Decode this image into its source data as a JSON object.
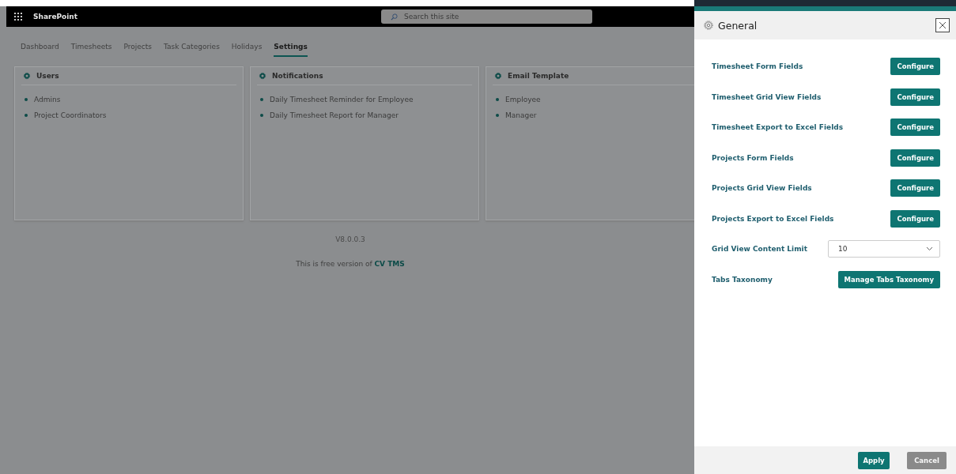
{
  "header": {
    "app_name": "SharePoint",
    "search_placeholder": "Search this site"
  },
  "tabs": [
    {
      "label": "Dashboard",
      "selected": false
    },
    {
      "label": "Timesheets",
      "selected": false
    },
    {
      "label": "Projects",
      "selected": false
    },
    {
      "label": "Task Categories",
      "selected": false
    },
    {
      "label": "Holidays",
      "selected": false
    },
    {
      "label": "Settings",
      "selected": true
    }
  ],
  "cards": [
    {
      "title": "Users",
      "items": [
        "Admins",
        "Project Coordinators"
      ]
    },
    {
      "title": "Notifications",
      "items": [
        "Daily Timesheet Reminder for Employee",
        "Daily Timesheet Report for Manager"
      ]
    },
    {
      "title": "Email Template",
      "items": [
        "Employee",
        "Manager"
      ]
    }
  ],
  "version": "V8.0.0.3",
  "footer_note": {
    "text": "This is free version of",
    "link": "CV TMS"
  },
  "panel": {
    "title": "General",
    "rows": [
      {
        "kind": "button",
        "label": "Timesheet Form Fields",
        "button": "Configure"
      },
      {
        "kind": "button",
        "label": "Timesheet Grid View Fields",
        "button": "Configure"
      },
      {
        "kind": "button",
        "label": "Timesheet Export to Excel Fields",
        "button": "Configure"
      },
      {
        "kind": "button",
        "label": "Projects Form Fields",
        "button": "Configure"
      },
      {
        "kind": "button",
        "label": "Projects Grid View Fields",
        "button": "Configure"
      },
      {
        "kind": "button",
        "label": "Projects Export to Excel Fields",
        "button": "Configure"
      },
      {
        "kind": "select",
        "label": "Grid View Content Limit",
        "value": "10"
      },
      {
        "kind": "button",
        "label": "Tabs Taxonomy",
        "button": "Manage Tabs Taxonomy"
      }
    ],
    "actions": [
      {
        "label": "Apply",
        "disabled": false
      },
      {
        "label": "Cancel",
        "disabled": true
      }
    ]
  }
}
